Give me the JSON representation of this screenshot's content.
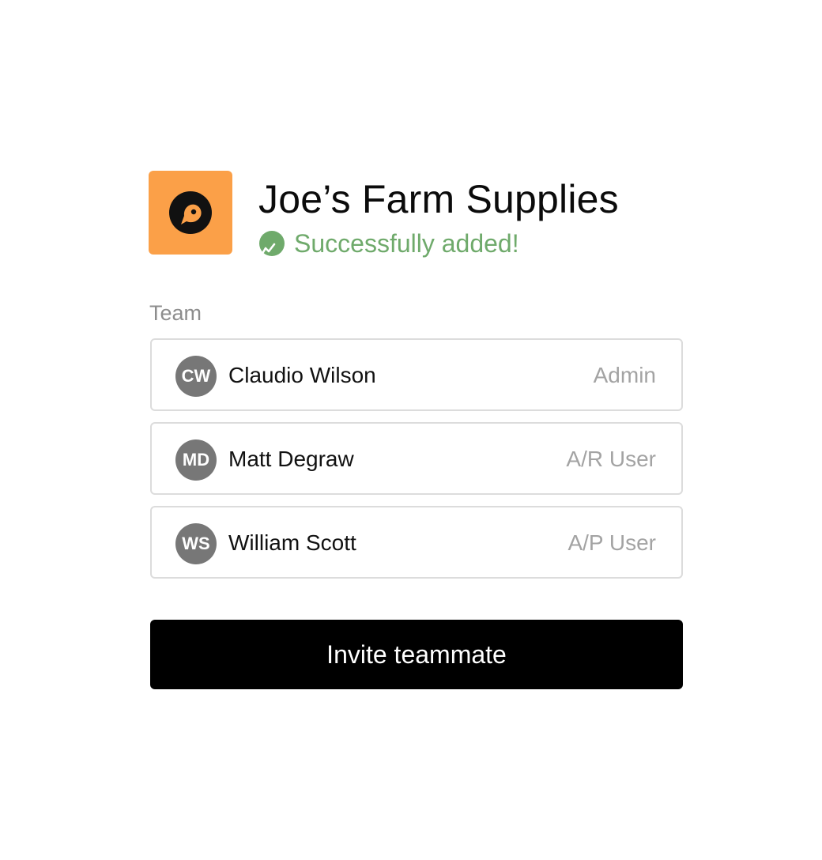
{
  "company": {
    "name": "Joe’s Farm Supplies",
    "logo_icon": "bird-logo-icon",
    "logo_color": "#FBA048",
    "status_icon": "success-check-icon",
    "status_text": "Successfully added!",
    "status_color": "#6FAA6B"
  },
  "team": {
    "label": "Team",
    "members": [
      {
        "initials": "CW",
        "name": "Claudio Wilson",
        "role": "Admin"
      },
      {
        "initials": "MD",
        "name": "Matt Degraw",
        "role": "A/R User"
      },
      {
        "initials": "WS",
        "name": "William Scott",
        "role": "A/P User"
      }
    ]
  },
  "actions": {
    "invite_label": "Invite teammate"
  }
}
